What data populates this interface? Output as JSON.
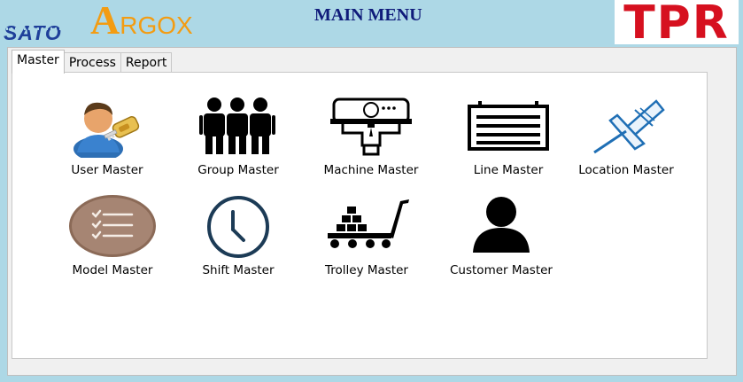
{
  "header": {
    "title": "MAIN MENU",
    "logo_left_1": "SATO",
    "logo_left_2_big": "A",
    "logo_left_2_small": "RGOX",
    "logo_right": "TPR"
  },
  "tabs": [
    {
      "label": "Master",
      "active": true
    },
    {
      "label": "Process",
      "active": false
    },
    {
      "label": "Report",
      "active": false
    }
  ],
  "tiles": {
    "user": "User Master",
    "group": "Group Master",
    "machine": "Machine Master",
    "line": "Line Master",
    "location": "Location Master",
    "model": "Model Master",
    "shift": "Shift Master",
    "trolley": "Trolley Master",
    "customer": "Customer Master"
  },
  "colors": {
    "background": "#add8e6",
    "title": "#0f1b7a",
    "tpr_red": "#d6101f",
    "argox_orange": "#f39c12",
    "sato_blue": "#1f3f9a",
    "power_orange": "#f47c20"
  },
  "icons": {
    "power": "power-icon",
    "key_lock": "key-lock-icon"
  }
}
